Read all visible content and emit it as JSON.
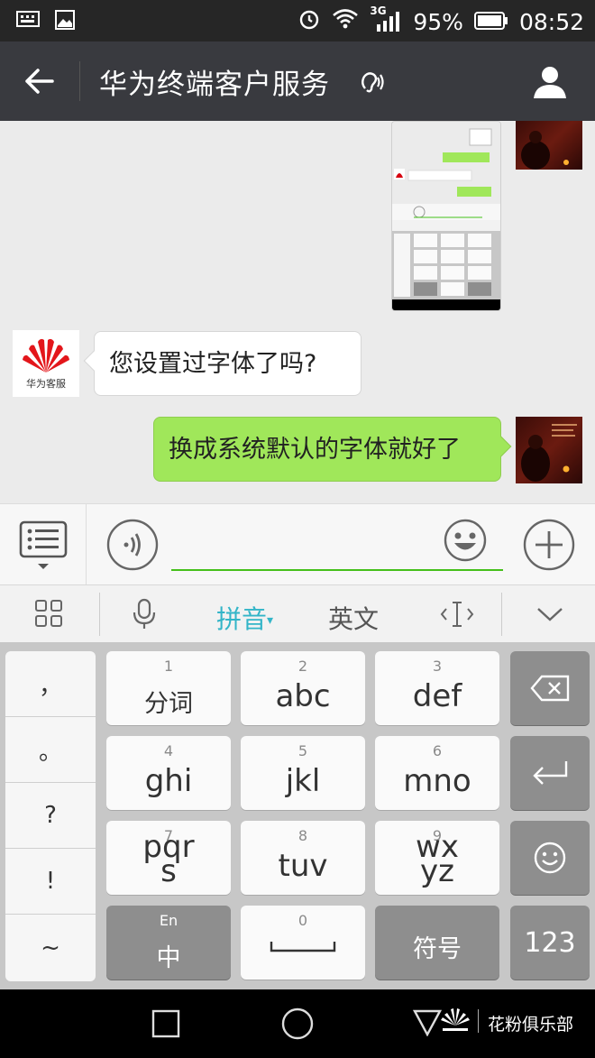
{
  "status_bar": {
    "network": "3G",
    "battery": "95%",
    "time": "08:52"
  },
  "title_bar": {
    "title": "华为终端客户服务"
  },
  "messages": [
    {
      "from": "agent",
      "text": "您设置过字体了吗?",
      "avatar_label": "华为客服"
    },
    {
      "from": "me",
      "text": "换成系统默认的字体就好了"
    }
  ],
  "colors": {
    "accent_green": "#45c01a",
    "bubble_out": "#a0e75a",
    "title_bg": "#393a3f"
  },
  "ime_toolbar": {
    "pinyin": "拼音",
    "english": "英文"
  },
  "keyboard": {
    "punctuation": [
      "，",
      "。",
      "?",
      "!",
      "~"
    ],
    "keys": [
      {
        "num": "1",
        "label": "分词"
      },
      {
        "num": "2",
        "label": "abc"
      },
      {
        "num": "3",
        "label": "def"
      },
      {
        "num": "4",
        "label": "ghi"
      },
      {
        "num": "5",
        "label": "jkl"
      },
      {
        "num": "6",
        "label": "mno"
      },
      {
        "num": "7",
        "label": "pqrs"
      },
      {
        "num": "8",
        "label": "tuv"
      },
      {
        "num": "9",
        "label": "wxyz"
      }
    ],
    "lang_key": {
      "small": "En",
      "label": "中"
    },
    "space_key": {
      "num": "0"
    },
    "symbols_key": "符号",
    "num_key": "123"
  },
  "nav_bar": {
    "brand": "花粉俱乐部"
  }
}
